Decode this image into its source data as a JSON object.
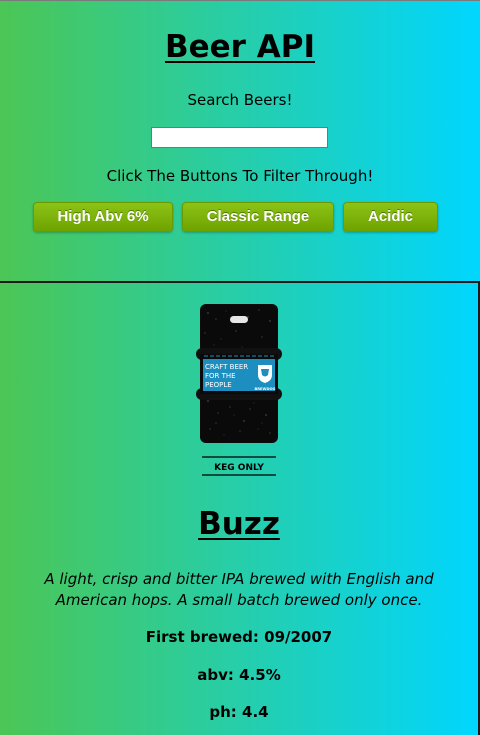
{
  "header": {
    "title": "Beer API",
    "search_label": "Search Beers!",
    "search": {
      "value": "",
      "placeholder": ""
    },
    "filter_label": "Click The Buttons To Filter Through!"
  },
  "filters": {
    "high_abv_label": "High Abv 6%",
    "classic_range_label": "Classic Range",
    "acidic_label": "Acidic"
  },
  "colors": {
    "gradient_start": "#4cc655",
    "gradient_end": "#00d6ff",
    "button_green": "#7cb30a"
  },
  "beer": {
    "name": "Buzz",
    "image": {
      "label_line1": "CRAFT BEER",
      "label_line2": "FOR THE",
      "label_line3": "PEOPLE",
      "brand": "BREWDOG",
      "caption": "KEG ONLY"
    },
    "description": "A light, crisp and bitter IPA brewed with English and American hops. A small batch brewed only once.",
    "first_brewed": "First brewed: 09/2007",
    "abv": "abv: 4.5%",
    "ph": "ph: 4.4"
  }
}
